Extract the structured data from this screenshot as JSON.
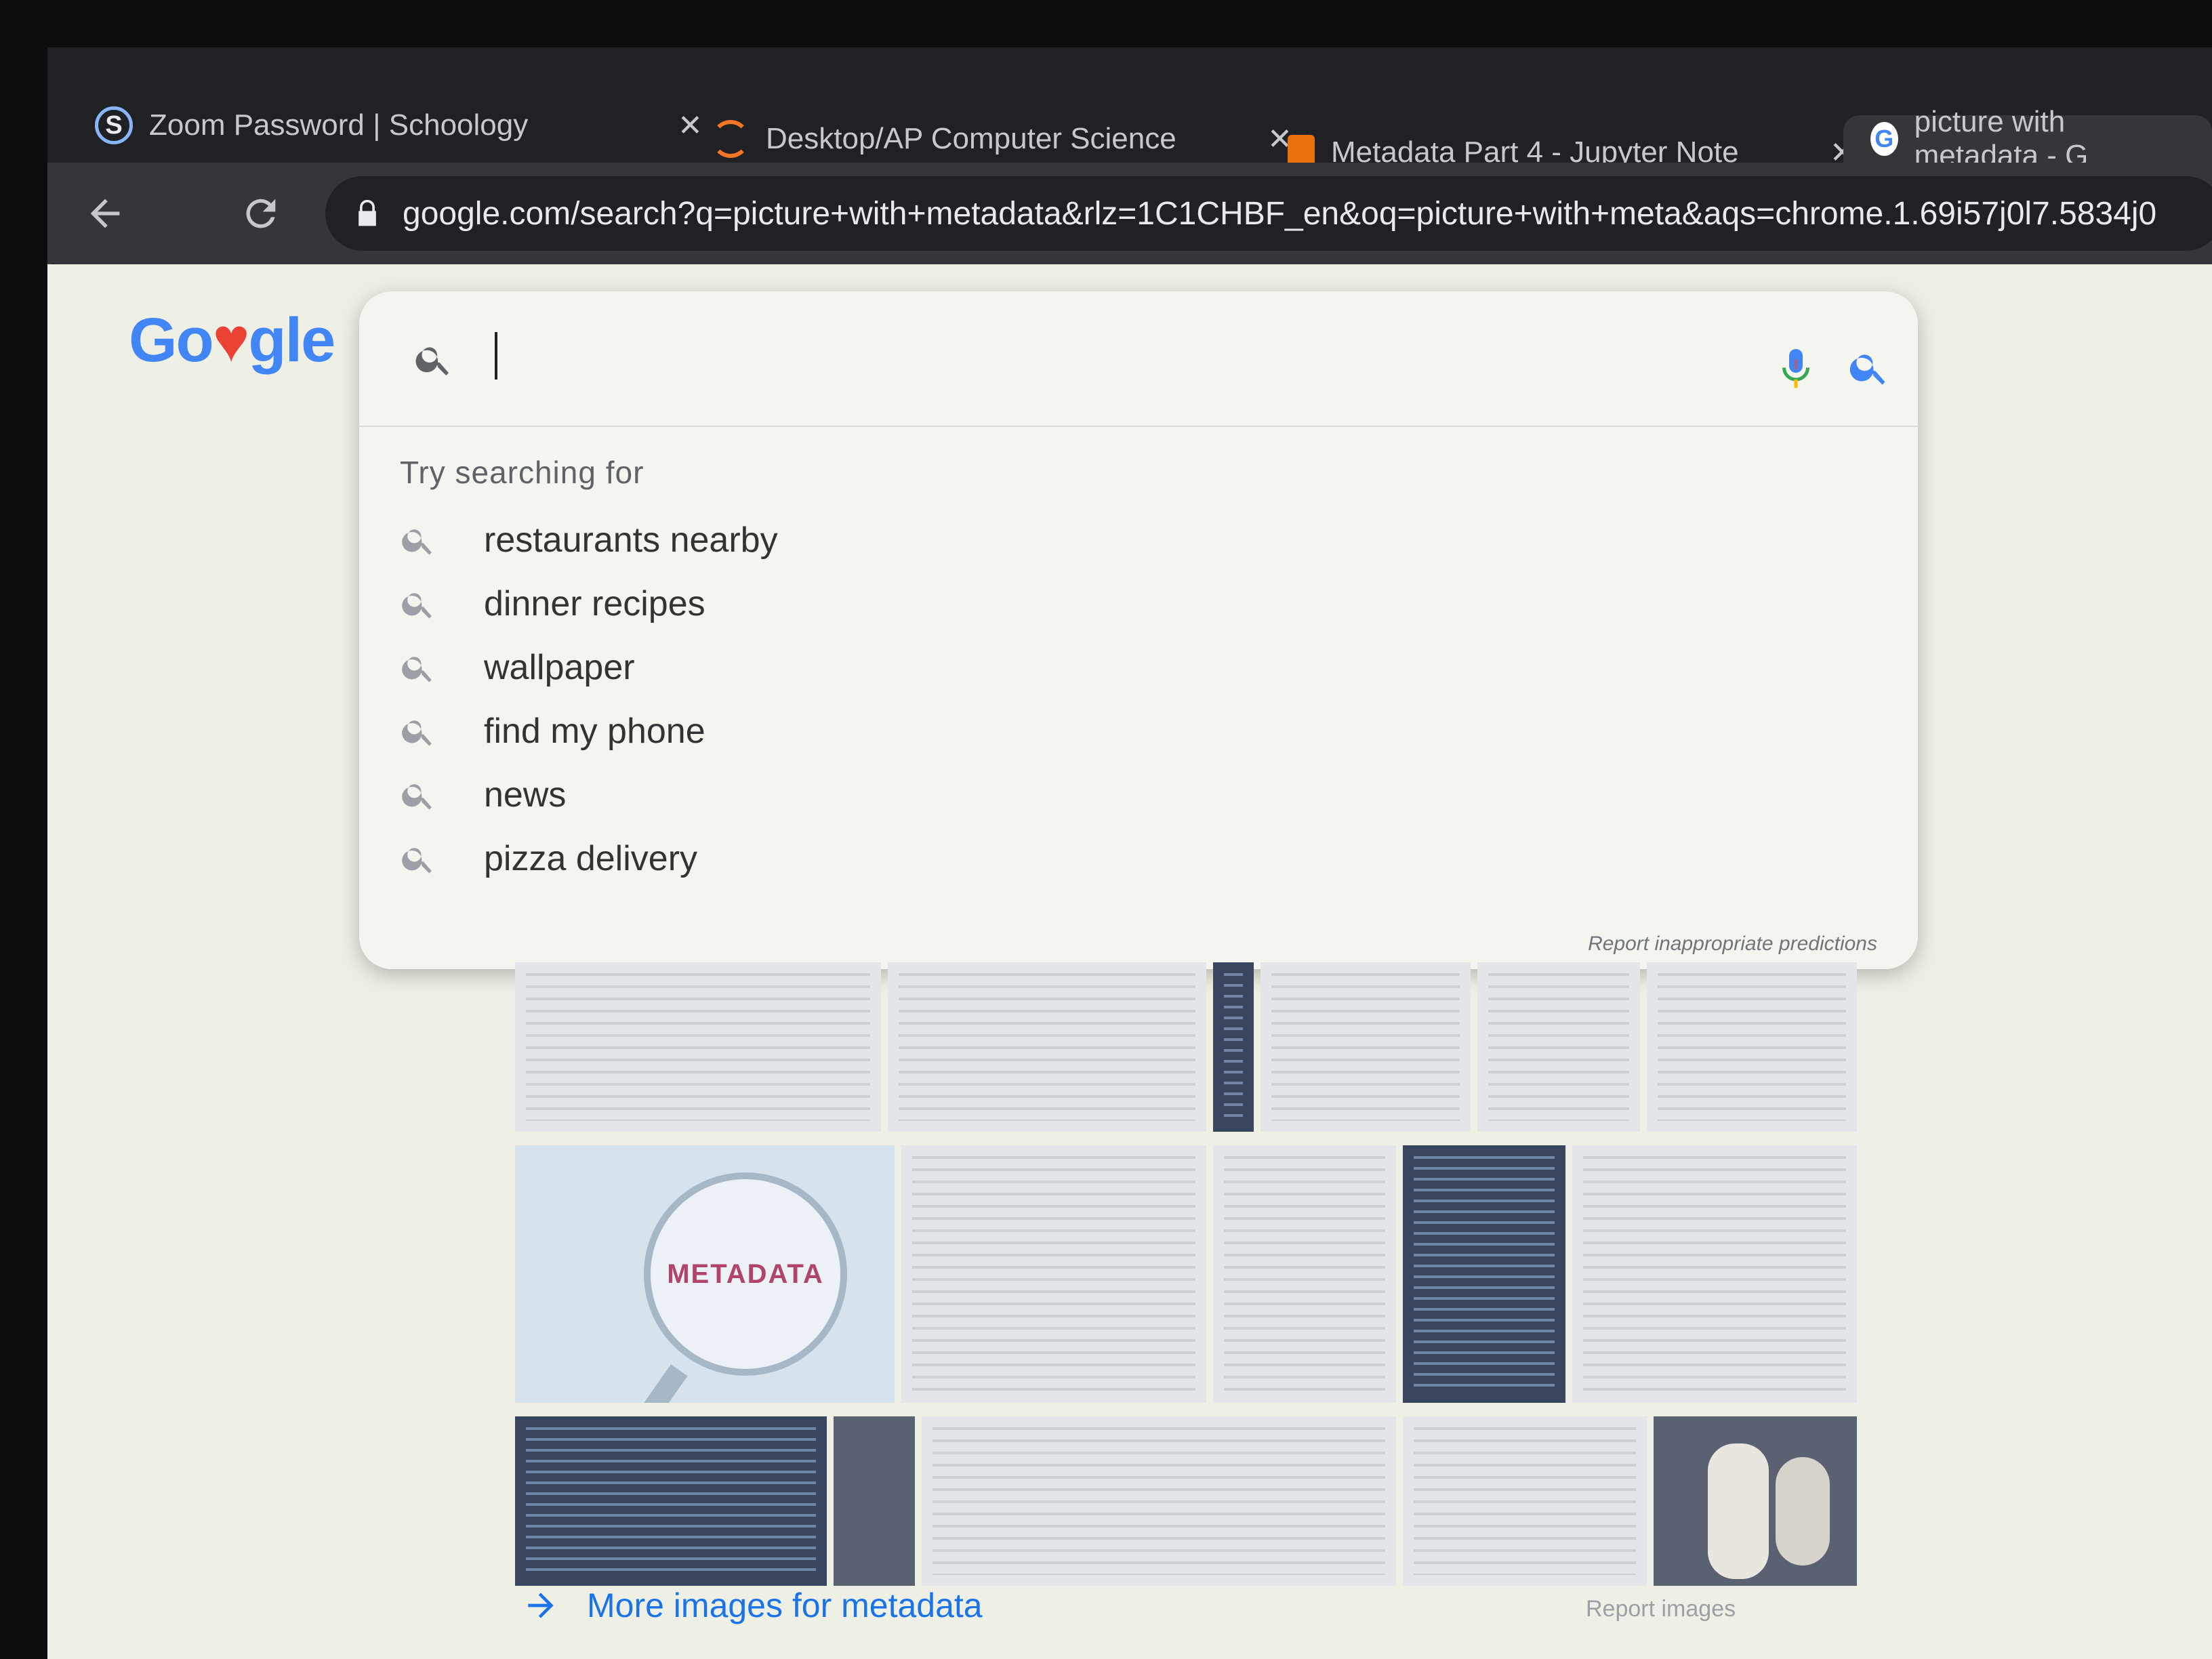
{
  "tabs": [
    {
      "label": "Zoom Password | Schoology",
      "favicon": "schoology-icon",
      "closable": true
    },
    {
      "label": "Desktop/AP Computer Science",
      "favicon": "jupyter-icon",
      "closable": true
    },
    {
      "label": "Metadata Part 4 - Jupyter Note",
      "favicon": "notebook-icon",
      "closable": true
    },
    {
      "label": "picture with metadata - G",
      "favicon": "google-icon",
      "active": true
    }
  ],
  "toolbar": {
    "back_icon": "arrow-left-icon",
    "reload_icon": "reload-icon",
    "url": "google.com/search?q=picture+with+metadata&rlz=1C1CHBF_en&oq=picture+with+meta&aqs=chrome.1.69i57j0l7.5834j0"
  },
  "logo": {
    "parts": [
      "Go",
      "♥",
      "gle"
    ]
  },
  "search": {
    "value": "",
    "try_label": "Try searching for",
    "suggestions": [
      "restaurants nearby",
      "dinner recipes",
      "wallpaper",
      "find my phone",
      "news",
      "pizza delivery"
    ],
    "report_predictions": "Report inappropriate predictions"
  },
  "image_results": {
    "metadata_thumb_text": "METADATA",
    "more_link": "More images for metadata",
    "report_link": "Report images"
  },
  "colors": {
    "google_blue": "#4285f4",
    "google_red": "#ea4335",
    "google_yellow": "#fbbc05",
    "google_green": "#34a853",
    "link_blue": "#1a73e8"
  }
}
